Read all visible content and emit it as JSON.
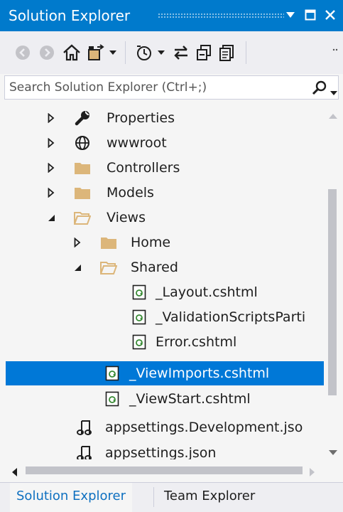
{
  "window": {
    "title": "Solution Explorer",
    "buttons": [
      "menu-dropdown",
      "maximize",
      "close"
    ]
  },
  "toolbar": {
    "items": [
      {
        "name": "back-button",
        "icon": "circle-left-arrow",
        "enabled": false
      },
      {
        "name": "forward-button",
        "icon": "circle-right-arrow",
        "enabled": false
      },
      {
        "name": "home-button",
        "icon": "home"
      },
      {
        "name": "switch-views-button",
        "icon": "switch-views"
      },
      {
        "name": "pending-changes-filter-button",
        "icon": "clock"
      },
      {
        "name": "sync-active-document-button",
        "icon": "sync-arrows"
      },
      {
        "name": "collapse-all-button",
        "icon": "collapse-all"
      },
      {
        "name": "show-all-files-button",
        "icon": "show-all-files"
      },
      {
        "name": "toolbar-overflow",
        "icon": "overflow"
      }
    ]
  },
  "search": {
    "placeholder": "Search Solution Explorer (Ctrl+;)",
    "value": "",
    "icon": "magnifier-icon"
  },
  "tree": {
    "items": [
      {
        "label": "Properties",
        "icon": "wrench",
        "expander": "collapsed",
        "level": 0,
        "selected": false
      },
      {
        "label": "wwwroot",
        "icon": "globe",
        "expander": "collapsed",
        "level": 0,
        "selected": false
      },
      {
        "label": "Controllers",
        "icon": "folder",
        "expander": "collapsed",
        "level": 0,
        "selected": false
      },
      {
        "label": "Models",
        "icon": "folder",
        "expander": "collapsed",
        "level": 0,
        "selected": false
      },
      {
        "label": "Views",
        "icon": "folder-open",
        "expander": "expanded",
        "level": 0,
        "selected": false
      },
      {
        "label": "Home",
        "icon": "folder",
        "expander": "collapsed",
        "level": 1,
        "selected": false
      },
      {
        "label": "Shared",
        "icon": "folder-open",
        "expander": "expanded",
        "level": 1,
        "selected": false
      },
      {
        "label": "_Layout.cshtml",
        "icon": "razor-file",
        "expander": "none",
        "level": 2,
        "selected": false
      },
      {
        "label": "_ValidationScriptsParti",
        "icon": "razor-file",
        "expander": "none",
        "level": 2,
        "selected": false
      },
      {
        "label": "Error.cshtml",
        "icon": "razor-file",
        "expander": "none",
        "level": 2,
        "selected": false
      },
      {
        "label": "_ViewImports.cshtml",
        "icon": "razor-file",
        "expander": "none",
        "level": 1,
        "selected": true
      },
      {
        "label": "_ViewStart.cshtml",
        "icon": "razor-file",
        "expander": "none",
        "level": 1,
        "selected": false
      },
      {
        "label": "appsettings.Development.jso",
        "icon": "json-settings",
        "expander": "none",
        "level": 0,
        "selected": false
      },
      {
        "label": "appsettings.json",
        "icon": "json-settings",
        "expander": "none",
        "level": 0,
        "selected": false
      }
    ]
  },
  "tabs": [
    {
      "label": "Solution Explorer",
      "active": true
    },
    {
      "label": "Team Explorer",
      "active": false
    }
  ],
  "colors": {
    "accent": "#007acc",
    "selection": "#0078d7",
    "folder": "#dcb67a",
    "background": "#f5f5f5",
    "activeTabText": "#0e70c0"
  }
}
